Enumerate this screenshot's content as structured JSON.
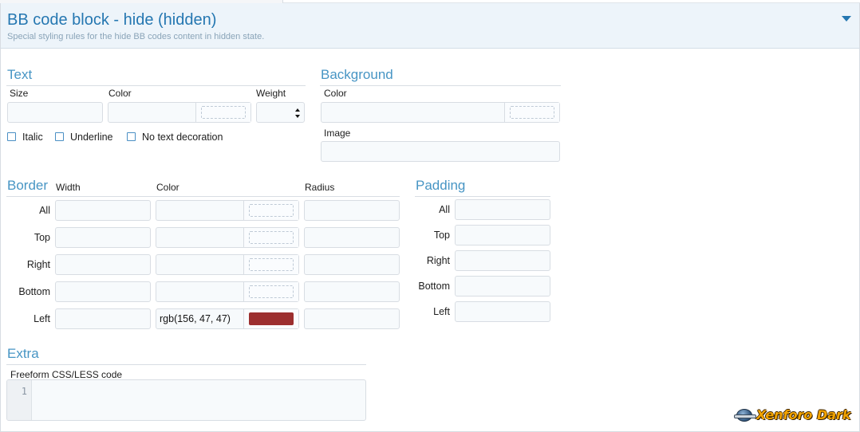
{
  "header": {
    "title": "BB code block - hide (hidden)",
    "description": "Special styling rules for the hide BB codes content in hidden state."
  },
  "text_section": {
    "title": "Text",
    "size_label": "Size",
    "color_label": "Color",
    "weight_label": "Weight",
    "size_value": "",
    "color_value": "",
    "weight_value": "",
    "checkboxes": {
      "italic": "Italic",
      "underline": "Underline",
      "no_decoration": "No text decoration"
    }
  },
  "background_section": {
    "title": "Background",
    "color_label": "Color",
    "image_label": "Image",
    "color_value": "",
    "image_value": ""
  },
  "border_section": {
    "title": "Border",
    "width_label": "Width",
    "color_label": "Color",
    "radius_label": "Radius",
    "rows": [
      {
        "label": "All",
        "color": ""
      },
      {
        "label": "Top",
        "color": ""
      },
      {
        "label": "Right",
        "color": ""
      },
      {
        "label": "Bottom",
        "color": ""
      },
      {
        "label": "Left",
        "color": "rgb(156, 47, 47)"
      }
    ],
    "left_swatch_color": "#9c2f2f"
  },
  "padding_section": {
    "title": "Padding",
    "rows": [
      {
        "label": "All"
      },
      {
        "label": "Top"
      },
      {
        "label": "Right"
      },
      {
        "label": "Bottom"
      },
      {
        "label": "Left"
      }
    ]
  },
  "extra_section": {
    "title": "Extra",
    "css_label": "Freeform CSS/LESS code",
    "line_number": "1",
    "code_value": ""
  },
  "watermark": {
    "text": "Xenforo Dark"
  }
}
